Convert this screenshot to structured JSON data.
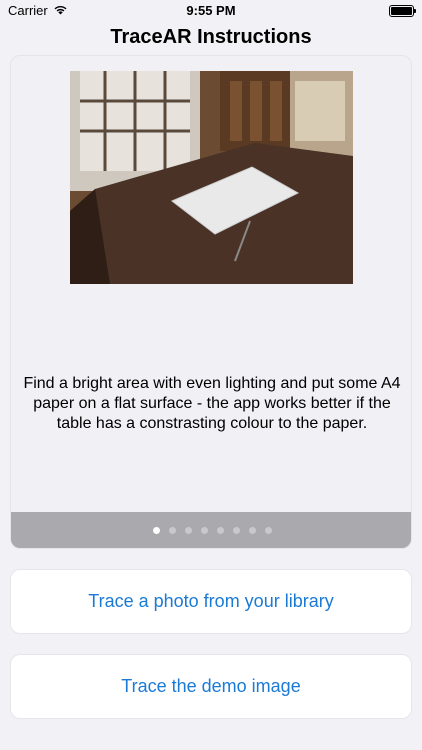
{
  "status_bar": {
    "carrier": "Carrier",
    "time": "9:55 PM",
    "battery_level": 1.0
  },
  "nav": {
    "title": "TraceAR Instructions"
  },
  "tutorial": {
    "image_icon": "photo-paper-on-table",
    "caption": "Find a bright area with even lighting and put some A4 paper on a flat surface - the app works better if the table has a constrasting colour to the paper.",
    "pages_total": 8,
    "current_page": 1
  },
  "actions": {
    "trace_library_label": "Trace a photo from your library",
    "trace_demo_label": "Trace the demo image"
  },
  "colors": {
    "accent": "#1b7ad6",
    "background": "#f2f2f6"
  }
}
